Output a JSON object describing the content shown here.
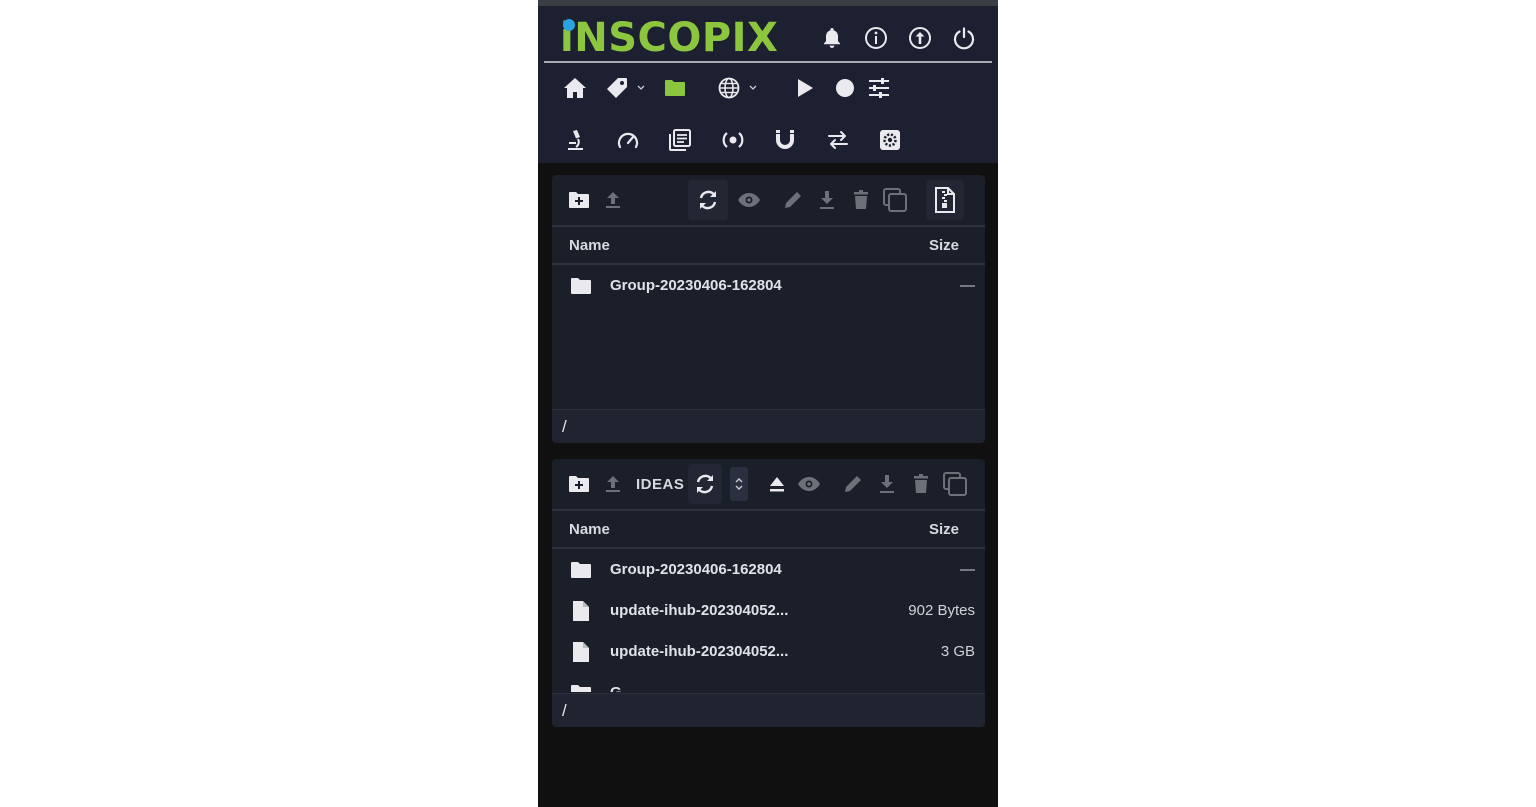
{
  "app": {
    "brand": "iNSCOPIX",
    "accent_color": "#8cc63f",
    "dot_color": "#2aa3e0"
  },
  "header_icons": [
    "bell-icon",
    "info-icon",
    "upload-circle-icon",
    "power-icon"
  ],
  "nav_row1": [
    "home-icon",
    "tag-icon",
    "folder-icon",
    "globe-icon",
    "play-icon",
    "record-icon",
    "sliders-icon"
  ],
  "nav_row2": [
    "microscope-icon",
    "gauge-icon",
    "library-icon",
    "broadcast-icon",
    "magnet-icon",
    "transfer-icon",
    "settings-icon"
  ],
  "panel1": {
    "col_name": "Name",
    "col_size": "Size",
    "rows": [
      {
        "icon": "folder-icon",
        "name": "Group-20230406-162804",
        "size": "—"
      }
    ],
    "path": "/"
  },
  "panel2": {
    "storage_label": "IDEAS",
    "col_name": "Name",
    "col_size": "Size",
    "rows": [
      {
        "icon": "folder-icon",
        "name": "Group-20230406-162804",
        "size": "—"
      },
      {
        "icon": "file-icon",
        "name": "update-ihub-202304052...",
        "size": "902 Bytes"
      },
      {
        "icon": "file-icon",
        "name": "update-ihub-202304052...",
        "size": "3 GB"
      },
      {
        "icon": "folder-icon",
        "name": "G",
        "size": ""
      }
    ],
    "path": "/"
  }
}
